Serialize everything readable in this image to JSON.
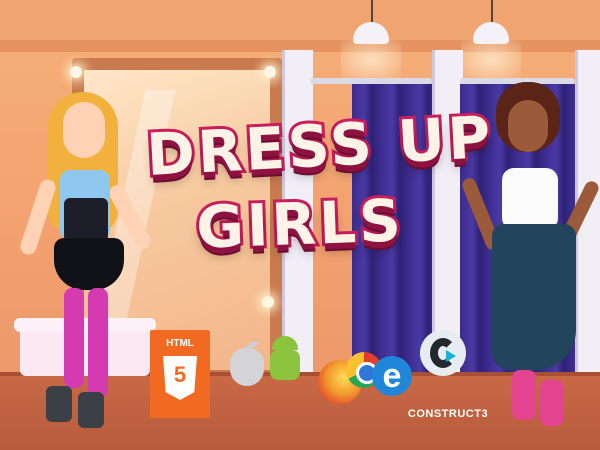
{
  "title": {
    "line1": "DRESS UP",
    "line2": "GIRLS"
  },
  "badges": {
    "html5_label": "HTML",
    "html5_number": "5",
    "construct_label": "CONSTRUCT3"
  },
  "icons": [
    "html5-icon",
    "apple-icon",
    "android-icon",
    "firefox-icon",
    "chrome-icon",
    "internet-explorer-icon",
    "construct3-icon"
  ],
  "colors": {
    "title_fill": "#fff2e6",
    "title_outline": "#c81e5c",
    "html5_orange": "#f26a21",
    "curtain_purple": "#3b2b8c"
  }
}
